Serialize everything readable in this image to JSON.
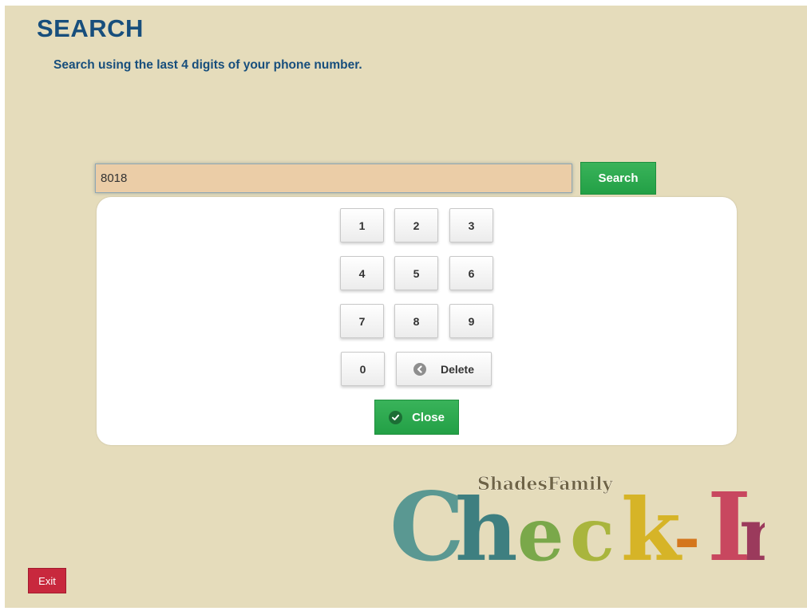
{
  "header": {
    "title": "SEARCH",
    "subtitle": "Search using the last 4 digits of your phone number."
  },
  "search": {
    "value": "8018",
    "button_label": "Search"
  },
  "keypad": {
    "keys": [
      "1",
      "2",
      "3",
      "4",
      "5",
      "6",
      "7",
      "8",
      "9",
      "0"
    ],
    "delete_label": "Delete",
    "close_label": "Close",
    "delete_icon": "chevron-left-circle-icon",
    "close_icon": "check-circle-icon"
  },
  "logo": {
    "top_text": "ShadesFamily",
    "main_letters": [
      "C",
      "h",
      "e",
      "c",
      "k",
      "-",
      "I",
      "n"
    ],
    "colors": [
      "#5a9892",
      "#3e7f80",
      "#7aa84a",
      "#a9b53d",
      "#d6b427",
      "#d4761c",
      "#c8475f",
      "#9b3a5c"
    ]
  },
  "footer": {
    "exit_label": "Exit"
  },
  "colors": {
    "background": "#e5dcbb",
    "accent_blue": "#174e7c",
    "input_bg": "#ebcda7",
    "green": "#2ba84d",
    "red": "#c8283d"
  }
}
